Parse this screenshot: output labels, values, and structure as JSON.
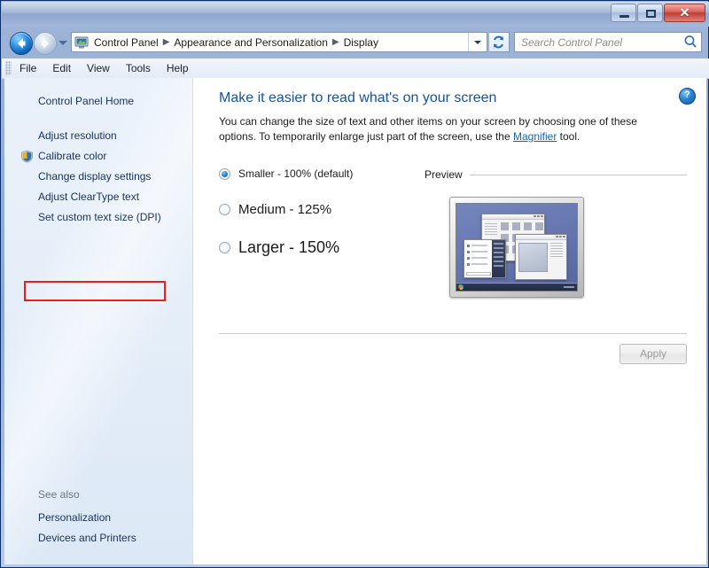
{
  "window": {
    "minimize_tooltip": "Minimize",
    "maximize_tooltip": "Maximize",
    "close_glyph": "✕"
  },
  "nav": {
    "back_tooltip": "Back",
    "forward_tooltip": "Forward",
    "recent_pages_tooltip": "Recent Pages",
    "breadcrumbs": [
      "Control Panel",
      "Appearance and Personalization",
      "Display"
    ],
    "separator": "▶",
    "refresh_tooltip": "Refresh",
    "address_icon": "monitor-icon"
  },
  "search": {
    "placeholder": "Search Control Panel",
    "icon": "search-icon"
  },
  "menubar": {
    "items": [
      "File",
      "Edit",
      "View",
      "Tools",
      "Help"
    ]
  },
  "sidebar": {
    "home_label": "Control Panel Home",
    "links": [
      {
        "label": "Adjust resolution",
        "shield": false
      },
      {
        "label": "Calibrate color",
        "shield": true
      },
      {
        "label": "Change display settings",
        "shield": false
      },
      {
        "label": "Adjust ClearType text",
        "shield": false
      },
      {
        "label": "Set custom text size (DPI)",
        "shield": false
      }
    ],
    "see_also_title": "See also",
    "see_also_links": [
      "Personalization",
      "Devices and Printers"
    ],
    "highlight_color": "#e8201a"
  },
  "main": {
    "help_glyph": "?",
    "heading": "Make it easier to read what's on your screen",
    "description_before_link": "You can change the size of text and other items on your screen by choosing one of these options. To temporarily enlarge just part of the screen, use the ",
    "description_link": "Magnifier",
    "description_after_link": " tool.",
    "options": [
      {
        "label": "Smaller - 100% (default)",
        "selected": true
      },
      {
        "label": "Medium - 125%",
        "selected": false
      },
      {
        "label": "Larger - 150%",
        "selected": false
      }
    ],
    "preview_label": "Preview",
    "apply_label": "Apply",
    "apply_enabled": false
  },
  "colors": {
    "heading": "#16529e",
    "link": "#1763b5",
    "sidebar_link": "#16325c",
    "annotation": "#e8201a",
    "wallpaper": "#6373ac"
  }
}
